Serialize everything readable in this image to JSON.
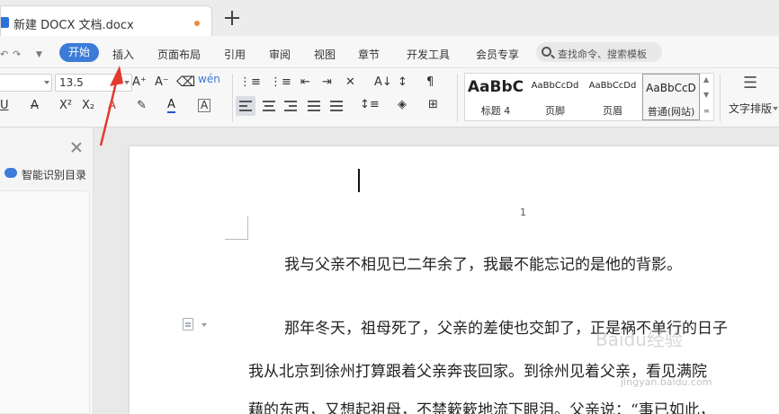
{
  "tab": {
    "title": "新建 DOCX 文档.docx"
  },
  "menu": {
    "start": "开始",
    "items": [
      "插入",
      "页面布局",
      "引用",
      "审阅",
      "视图",
      "章节",
      "开发工具",
      "会员专享"
    ],
    "search": "查找命令、搜索模板"
  },
  "ribbon": {
    "font_size": "13.5",
    "styles": [
      {
        "preview": "AaBbC",
        "label": "标题 4"
      },
      {
        "preview": "AaBbCcDd",
        "label": "页脚"
      },
      {
        "preview": "AaBbCcDd",
        "label": "页眉"
      },
      {
        "preview": "AaBbCcD",
        "label": "普通(网站)"
      }
    ],
    "text_layout": "文字排版"
  },
  "left_panel": {
    "smart_toc": "智能识别目录"
  },
  "document": {
    "page_number": "1",
    "lines": [
      "我与父亲不相见已二年余了，我最不能忘记的是他的背影。",
      "那年冬天，祖母死了，父亲的差使也交卸了，正是祸不单行的日子",
      "我从北京到徐州打算跟着父亲奔丧回家。到徐州见着父亲，看见满院",
      "藉的东西，又想起祖母，不禁簌簌地流下眼泪。父亲说：“事已如此，"
    ]
  },
  "watermark": {
    "main": "Baidu经验",
    "sub": "jingyan.baidu.com"
  },
  "colors": {
    "accent": "#3d7bd8",
    "annotation": "#e23a2e",
    "modified_dot": "#f08a3e"
  }
}
